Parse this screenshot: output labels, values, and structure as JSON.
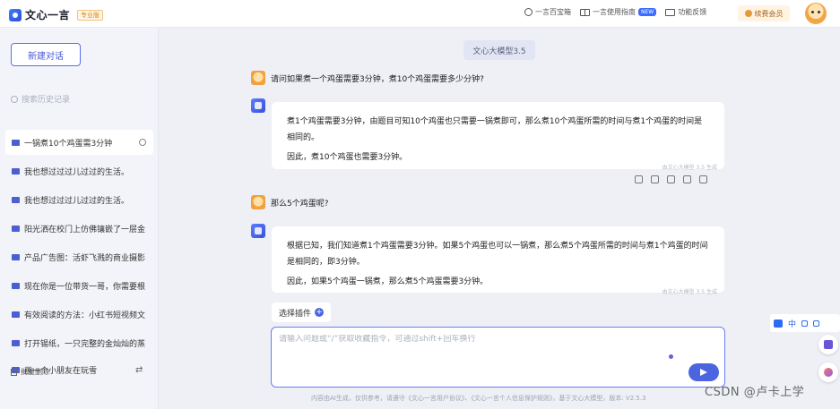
{
  "topbar": {
    "app_name": "文心一言",
    "badge": "专业版",
    "links": [
      {
        "label": "一言百宝箱",
        "icon": "compass-icon"
      },
      {
        "label": "一言使用指南",
        "icon": "book-icon",
        "badge": "NEW"
      },
      {
        "label": "功能反馈",
        "icon": "mail-icon"
      }
    ],
    "vip_label": "续费会员"
  },
  "sidebar": {
    "new_chat_label": "新建对话",
    "search_placeholder": "搜索历史记录",
    "items": [
      {
        "label": "一锅煮10个鸡蛋需3分钟"
      },
      {
        "label": "我也想过过过儿过过的生活。"
      },
      {
        "label": "我也想过过过儿过过的生活。"
      },
      {
        "label": "阳光洒在校门上仿佛镶嵌了一层金"
      },
      {
        "label": "产品广告图：活虾飞溅的商业摄影"
      },
      {
        "label": "现在你是一位带货一哥，你需要根"
      },
      {
        "label": "有效阅读的方法：小红书短视频文"
      },
      {
        "label": "打开锡纸，一只完整的金灿灿的蒸"
      },
      {
        "label": "画一个小朋友在玩雪"
      }
    ],
    "batch_delete_label": "批量删除"
  },
  "chat": {
    "model_label": "文心大模型3.5",
    "turns": [
      {
        "question": "请问如果煮一个鸡蛋需要3分钟，煮10个鸡蛋需要多少分钟?",
        "answer": [
          "煮1个鸡蛋需要3分钟，由题目可知10个鸡蛋也只需要一锅煮即可，那么煮10个鸡蛋所需的时间与煮1个鸡蛋的时间是相同的。",
          "因此，煮10个鸡蛋也需要3分钟。"
        ],
        "gen_note": "由文心大模型 3.5 生成"
      },
      {
        "question": "那么5个鸡蛋呢?",
        "answer": [
          "根据已知，我们知道煮1个鸡蛋需要3分钟。如果5个鸡蛋也可以一锅煮，那么煮5个鸡蛋所需的时间与煮1个鸡蛋的时间是相同的，即3分钟。",
          "因此，如果5个鸡蛋一锅煮，那么煮5个鸡蛋需要3分钟。"
        ],
        "gen_note": "由文心大模型 3.5 生成"
      }
    ]
  },
  "composer": {
    "plugin_label": "选择插件",
    "placeholder": "请输入问题或“/”获取收藏指令，可通过shift+回车换行"
  },
  "footer": "内容由AI生成，仅供参考，请遵守《文心一言用户协议》、《文心一言个人信息保护规则》，基于文心大模型，版本: V2.5.3",
  "float_bar": {
    "label": "中"
  },
  "watermark": "CSDN @卢卡上学"
}
